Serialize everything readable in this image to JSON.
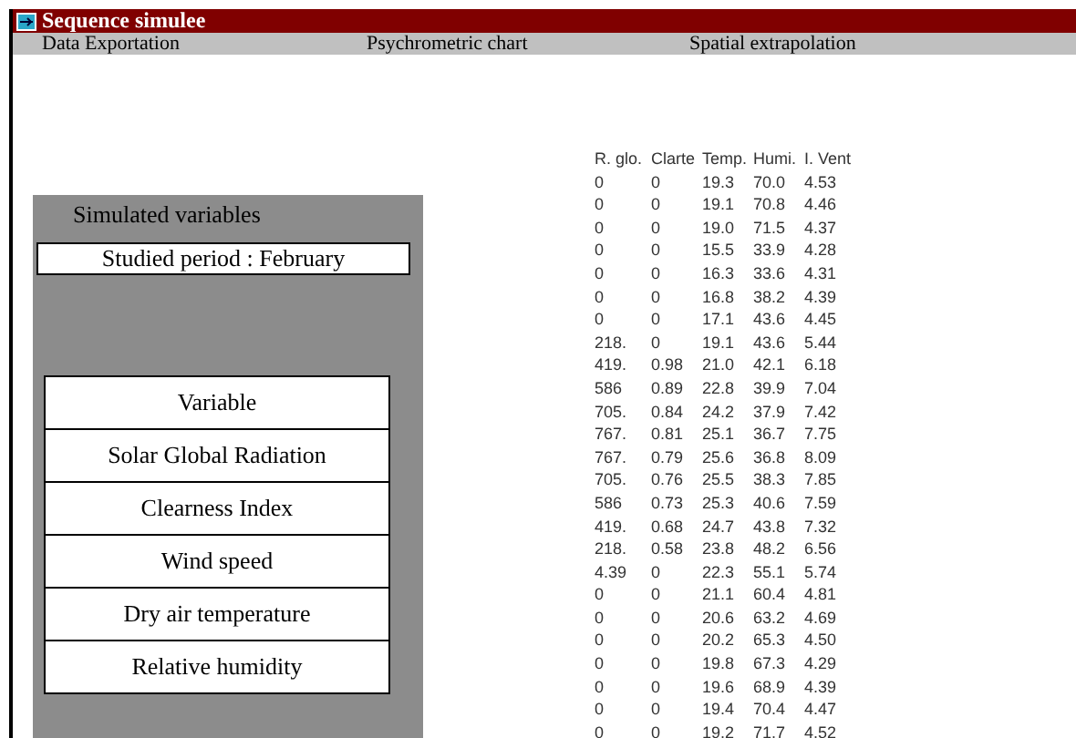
{
  "window": {
    "title": "Sequence simulee"
  },
  "menu": [
    "Data Exportation",
    "Psychrometric chart",
    "Spatial extrapolation"
  ],
  "panel": {
    "title": "Simulated variables",
    "period": "Studied period : February",
    "variables": [
      "Variable",
      "Solar Global Radiation",
      "Clearness Index",
      "Wind speed",
      "Dry air temperature",
      "Relative humidity"
    ]
  },
  "data": {
    "header": [
      "R. glo.",
      "Clarte",
      "Temp.",
      "Humi.",
      "I. Vent"
    ],
    "rows": [
      [
        "0",
        "0",
        "19.3",
        "70.0",
        "4.53"
      ],
      [
        "0",
        "0",
        "19.1",
        "70.8",
        "4.46"
      ],
      [
        "0",
        "0",
        "19.0",
        "71.5",
        "4.37"
      ],
      [
        "0",
        "0",
        "15.5",
        "33.9",
        "4.28"
      ],
      [
        "0",
        "0",
        "16.3",
        "33.6",
        "4.31"
      ],
      [
        "0",
        "0",
        "16.8",
        "38.2",
        "4.39"
      ],
      [
        "0",
        "0",
        "17.1",
        "43.6",
        "4.45"
      ],
      [
        "218.",
        "0",
        "19.1",
        "43.6",
        "5.44"
      ],
      [
        "419.",
        "0.98",
        "21.0",
        "42.1",
        "6.18"
      ],
      [
        "586",
        "0.89",
        "22.8",
        "39.9",
        "7.04"
      ],
      [
        "705.",
        "0.84",
        "24.2",
        "37.9",
        "7.42"
      ],
      [
        "767.",
        "0.81",
        "25.1",
        "36.7",
        "7.75"
      ],
      [
        "767.",
        "0.79",
        "25.6",
        "36.8",
        "8.09"
      ],
      [
        "705.",
        "0.76",
        "25.5",
        "38.3",
        "7.85"
      ],
      [
        "586",
        "0.73",
        "25.3",
        "40.6",
        "7.59"
      ],
      [
        "419.",
        "0.68",
        "24.7",
        "43.8",
        "7.32"
      ],
      [
        "218.",
        "0.58",
        "23.8",
        "48.2",
        "6.56"
      ],
      [
        "4.39",
        "0",
        "22.3",
        "55.1",
        "5.74"
      ],
      [
        "0",
        "0",
        "21.1",
        "60.4",
        "4.81"
      ],
      [
        "0",
        "0",
        "20.6",
        "63.2",
        "4.69"
      ],
      [
        "0",
        "0",
        "20.2",
        "65.3",
        "4.50"
      ],
      [
        "0",
        "0",
        "19.8",
        "67.3",
        "4.29"
      ],
      [
        "0",
        "0",
        "19.6",
        "68.9",
        "4.39"
      ],
      [
        "0",
        "0",
        "19.4",
        "70.4",
        "4.47"
      ],
      [
        "0",
        "0",
        "19.2",
        "71.7",
        "4.52"
      ]
    ]
  }
}
